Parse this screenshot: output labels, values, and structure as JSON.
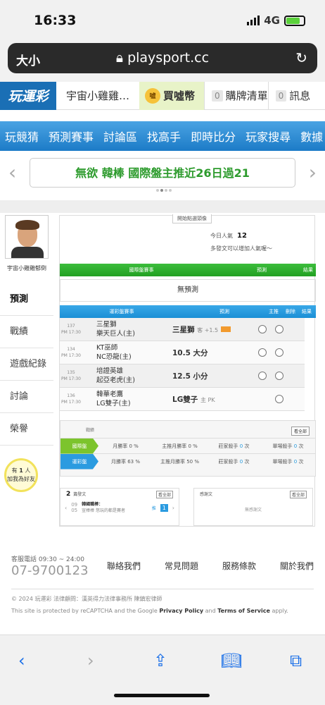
{
  "status_bar": {
    "time": "16:33",
    "network": "4G"
  },
  "browser": {
    "text_size_label": "大小",
    "url": "playsport.cc",
    "lock_icon": "lock-icon",
    "reload_icon": "reload-icon"
  },
  "top_nav": {
    "logo": "玩運彩",
    "user": "宇宙小雞雞…",
    "coin": {
      "icon": "噓",
      "label": "買噓幣"
    },
    "items": [
      {
        "count": "0",
        "label": "購牌清單"
      },
      {
        "count": "0",
        "label": "訊息"
      }
    ]
  },
  "main_menu": [
    "玩競猜",
    "預測賽事",
    "討論區",
    "找高手",
    "即時比分",
    "玩家搜尋",
    "數據"
  ],
  "promo_banner": {
    "text": "無欲 韓棒 國際盤主推近26日過21"
  },
  "sidebar": {
    "username": "宇宙小雞雞郁倒",
    "menu": [
      "預測",
      "戰績",
      "遊戲紀錄",
      "討論",
      "榮譽"
    ],
    "invite": {
      "line1": "有",
      "count": "1",
      "line1b": "人",
      "line2": "加我為好友"
    }
  },
  "profile": {
    "ribbon": "開始點選頭像",
    "today_views_label": "今日人氣",
    "today_views": "12",
    "hint": "多發文可以增加人氣喔～",
    "intl_header": {
      "game": "國際盤賽事",
      "pred": "預測",
      "result": "結果"
    },
    "no_prediction": "無預測",
    "lottery_header": {
      "game": "運彩盤賽事",
      "pred": "預測",
      "main": "主推",
      "del": "刪除",
      "result": "結果"
    },
    "games": [
      {
        "id": "137",
        "time": "PM 17:30",
        "away": "三星獅",
        "home": "樂天巨人(主)",
        "pick": "三星獅",
        "note": "客 +1.5"
      },
      {
        "id": "134",
        "time": "PM 17:30",
        "away": "KT巫師",
        "home": "NC恐龍(主)",
        "pick": "10.5 大分",
        "note": ""
      },
      {
        "id": "135",
        "time": "PM 17:30",
        "away": "培證英雄",
        "home": "起亞老虎(主)",
        "pick": "12.5 小分",
        "note": ""
      },
      {
        "id": "136",
        "time": "PM 17:30",
        "away": "韓華老鷹",
        "home": "LG雙子(主)",
        "pick": "LG雙子",
        "note": "主 PK"
      }
    ],
    "record": {
      "title": "戰績",
      "view_all": "看全部",
      "rows": [
        {
          "label": "國際盤",
          "color": "#7cc42d",
          "month_win_label": "月勝率",
          "month_win": "0 %",
          "main_month_label": "主推月勝率",
          "main_month": "0 %",
          "killer_label": "莊家殺手",
          "killer": "0",
          "killer_unit": "次",
          "single_label": "單場殺手",
          "single": "0",
          "single_unit": "次"
        },
        {
          "label": "運彩盤",
          "color": "#2b9be0",
          "month_win_label": "月勝率",
          "month_win": "63 %",
          "main_month_label": "主推月勝率",
          "main_month": "50 %",
          "killer_label": "莊家殺手",
          "killer": "0",
          "killer_unit": "次",
          "single_label": "單場殺手",
          "single": "0",
          "single_unit": "次"
        }
      ]
    },
    "posts": {
      "count": "2",
      "label": "篇發文",
      "view_all": "看全部",
      "month": "09",
      "day": "05",
      "title": "韓國職棒：",
      "subtitle": "宣棒棒 怒玩的都是賽者",
      "push_label": "推",
      "push_count": "1"
    },
    "thanks": {
      "label": "感謝文",
      "view_all": "看全部",
      "empty": "無感謝文"
    }
  },
  "footer": {
    "hours": "客服電話 09:30 ~ 24:00",
    "phone": "07-9700123",
    "links": [
      "聯絡我們",
      "常見問題",
      "服務條款",
      "關於我們"
    ],
    "copyright": "© 2024 玩運彩 法律顧問：漢英得力法律事務所 陳鎮宏律師",
    "captcha_pre": "This site is protected by reCAPTCHA and the Google",
    "privacy": "Privacy Policy",
    "and": "and",
    "terms": "Terms of Service",
    "apply": "apply."
  }
}
